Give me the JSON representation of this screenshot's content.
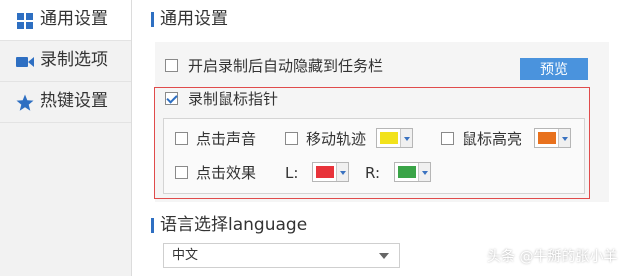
{
  "sidebar": {
    "items": [
      {
        "label": "通用设置",
        "icon": "grid-icon"
      },
      {
        "label": "录制选项",
        "icon": "video-icon"
      },
      {
        "label": "热键设置",
        "icon": "star-icon"
      }
    ]
  },
  "general": {
    "title": "通用设置",
    "auto_hide_label": "开启录制后自动隐藏到任务栏",
    "preview_label": "预览"
  },
  "mouse": {
    "record_pointer_label": "录制鼠标指针",
    "click_sound_label": "点击声音",
    "move_track_label": "移动轨迹",
    "highlight_label": "鼠标高亮",
    "click_effect_label": "点击效果",
    "left_label": "L:",
    "right_label": "R:",
    "colors": {
      "track": "#f2e21b",
      "highlight": "#e8711d",
      "left": "#e8333a",
      "right": "#3aa447"
    }
  },
  "language": {
    "title": "语言选择language",
    "selected": "中文"
  },
  "watermark": "头条 @牛掰的张小羊",
  "accent": "#2e6fc2"
}
